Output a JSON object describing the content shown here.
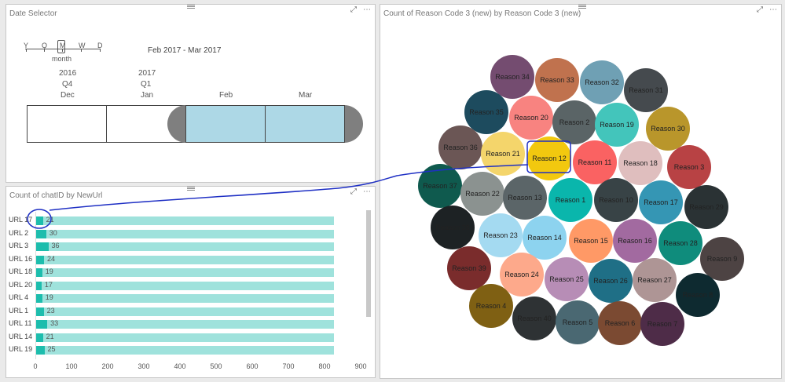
{
  "left_top_panel": {
    "title": "Date Selector",
    "granularity": [
      "Y",
      "Q",
      "M",
      "W",
      "D"
    ],
    "granularity_selected_label": "month",
    "range_text": "Feb 2017 - Mar 2017",
    "years": [
      "2016",
      "2017"
    ],
    "quarters": [
      "Q4",
      "Q1"
    ],
    "months": [
      "Dec",
      "Jan",
      "Feb",
      "Mar"
    ],
    "selected_months": [
      "Feb",
      "Mar"
    ],
    "selected_color": "#add8e6"
  },
  "left_bottom_panel": {
    "title": "Count of chatID by NewUrl",
    "bar_bg_color": "#9fe2dc",
    "bar_fg_color": "#1dbdad",
    "axis_ticks": [
      "0",
      "100",
      "200",
      "300",
      "400",
      "500",
      "600",
      "700",
      "800",
      "900"
    ],
    "chart_data": {
      "type": "bar",
      "categories": [
        "URL 17",
        "URL 2",
        "URL 3",
        "URL 16",
        "URL 18",
        "URL 20",
        "URL 4",
        "URL 1",
        "URL 11",
        "URL 14",
        "URL 19"
      ],
      "values": [
        21,
        30,
        36,
        24,
        19,
        17,
        19,
        23,
        33,
        21,
        25
      ],
      "background_total": 825,
      "xlim": [
        0,
        900
      ],
      "x_ticks": [
        0,
        100,
        200,
        300,
        400,
        500,
        600,
        700,
        800,
        900
      ]
    },
    "row_labels": [
      "URL 17",
      "URL 2",
      "URL 3",
      "URL 16",
      "URL 18",
      "URL 20",
      "URL 4",
      "URL 1",
      "URL 11",
      "URL 14",
      "URL 19"
    ],
    "value_labels": [
      "21",
      "30",
      "36",
      "24",
      "19",
      "17",
      "19",
      "23",
      "33",
      "21",
      "25"
    ]
  },
  "right_panel": {
    "title": "Count of Reason Code 3 (new) by Reason Code 3 (new)",
    "selected": "Reason 12",
    "bubbles": [
      {
        "label": "Reason 34",
        "color": "#744c70"
      },
      {
        "label": "Reason 33",
        "color": "#c0724e"
      },
      {
        "label": "Reason 32",
        "color": "#6fa0b4"
      },
      {
        "label": "Reason 31",
        "color": "#454a4e"
      },
      {
        "label": "Reason 35",
        "color": "#1d4b5e"
      },
      {
        "label": "Reason 20",
        "color": "#f88380"
      },
      {
        "label": "Reason 2",
        "color": "#5a6466"
      },
      {
        "label": "Reason 19",
        "color": "#43c5bb"
      },
      {
        "label": "Reason 30",
        "color": "#b9962b"
      },
      {
        "label": "Reason 36",
        "color": "#6b5655"
      },
      {
        "label": "Reason 21",
        "color": "#f4d56b"
      },
      {
        "label": "Reason 12",
        "color": "#f2c80f"
      },
      {
        "label": "Reason 11",
        "color": "#fa6262"
      },
      {
        "label": "Reason 18",
        "color": "#dfbebe"
      },
      {
        "label": "Reason 3",
        "color": "#b84244"
      },
      {
        "label": "Reason 37",
        "color": "#0f5a4e"
      },
      {
        "label": "Reason 22",
        "color": "#8b9290"
      },
      {
        "label": "Reason 13",
        "color": "#5b6568"
      },
      {
        "label": "Reason 1",
        "color": "#0ab6ac"
      },
      {
        "label": "Reason 10",
        "color": "#384346"
      },
      {
        "label": "Reason 17",
        "color": "#3596b4"
      },
      {
        "label": "Reason 29",
        "color": "#2a3234"
      },
      {
        "label": "Reason 38",
        "color": "#1d2224"
      },
      {
        "label": "Reason 23",
        "color": "#a4daf1"
      },
      {
        "label": "Reason 14",
        "color": "#8dd3ef"
      },
      {
        "label": "Reason 15",
        "color": "#ff9966"
      },
      {
        "label": "Reason 16",
        "color": "#a26aa0"
      },
      {
        "label": "Reason 28",
        "color": "#0f8c7c"
      },
      {
        "label": "Reason 9",
        "color": "#4d4343"
      },
      {
        "label": "Reason 39",
        "color": "#7a2c2c"
      },
      {
        "label": "Reason 24",
        "color": "#fda98b"
      },
      {
        "label": "Reason 25",
        "color": "#b78db6"
      },
      {
        "label": "Reason 26",
        "color": "#1f6f86"
      },
      {
        "label": "Reason 27",
        "color": "#ae9595"
      },
      {
        "label": "Reason 8",
        "color": "#0e2a30"
      },
      {
        "label": "Reason 4",
        "color": "#7f6013"
      },
      {
        "label": "Reason 40",
        "color": "#2e3234"
      },
      {
        "label": "Reason 5",
        "color": "#4a6872"
      },
      {
        "label": "Reason 6",
        "color": "#7b4a32"
      },
      {
        "label": "Reason 7",
        "color": "#4e2c48"
      }
    ]
  },
  "annotation_color": "#1e2fc4"
}
